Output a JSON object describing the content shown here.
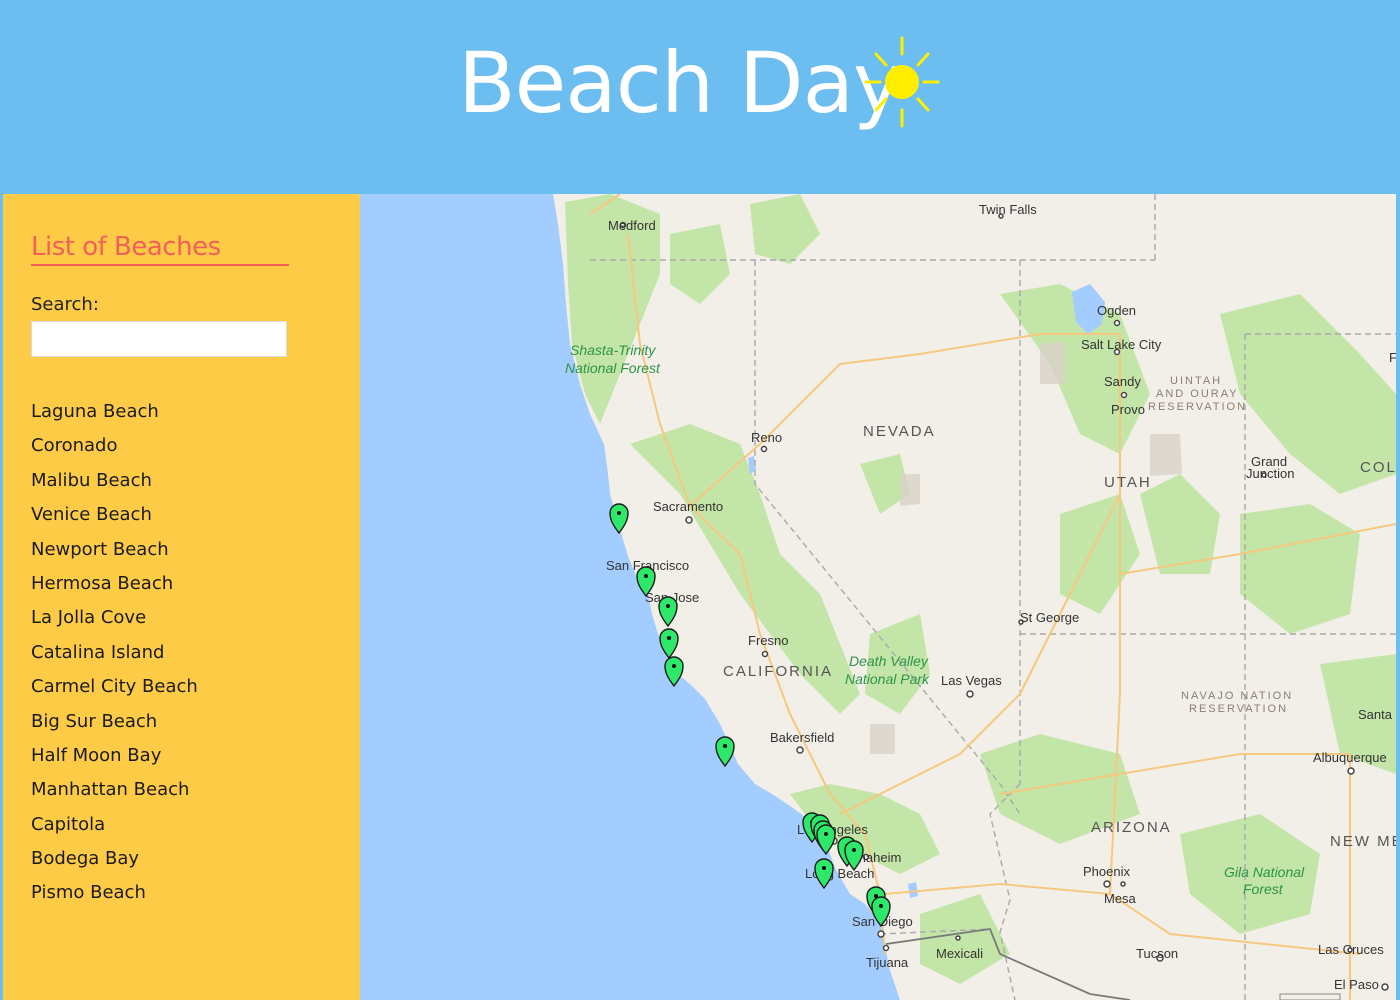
{
  "header": {
    "title": "Beach Day",
    "icon": "sun-icon",
    "background": "#6cbdf0"
  },
  "sidebar": {
    "title": "List of Beaches",
    "search_label": "Search:",
    "search_value": "",
    "background": "#fecb47",
    "accent": "#f2605a",
    "beaches": [
      "Laguna Beach",
      "Coronado",
      "Malibu Beach",
      "Venice Beach",
      "Newport Beach",
      "Hermosa Beach",
      "La Jolla Cove",
      "Catalina Island",
      "Carmel City Beach",
      "Big Sur Beach",
      "Half Moon Bay",
      "Manhattan Beach",
      "Capitola",
      "Bodega Bay",
      "Pismo Beach"
    ]
  },
  "map": {
    "marker_color": "#2ee86a",
    "ocean_color": "#a3ccff",
    "land_color": "#f2efe9",
    "labels": {
      "medford": "Medford",
      "twin_falls": "Twin Falls",
      "ogden": "Ogden",
      "salt_lake_city": "Salt Lake City",
      "sandy": "Sandy",
      "provo": "Provo",
      "uintah_1": "UINTAH",
      "uintah_2": "AND OURAY",
      "uintah_3": "RESERVATION",
      "shasta_1": "Shasta-Trinity",
      "shasta_2": "National Forest",
      "reno": "Reno",
      "nevada": "NEVADA",
      "utah": "UTAH",
      "grand_junction_1": "Grand",
      "grand_junction_2": "Junction",
      "colorado": "COLO",
      "sacramento": "Sacramento",
      "san_francisco": "San Francisco",
      "san_jose": "San Jose",
      "st_george": "St George",
      "fresno": "Fresno",
      "california": "CALIFORNIA",
      "death_valley_1": "Death Valley",
      "death_valley_2": "National Park",
      "las_vegas": "Las Vegas",
      "navajo_1": "NAVAJO NATION",
      "navajo_2": "RESERVATION",
      "santa_fe": "Santa F",
      "bakersfield": "Bakersfield",
      "albuquerque": "Albuquerque",
      "los_angeles": "Los Angeles",
      "anaheim": "Anaheim",
      "long_beach": "Long Beach",
      "arizona": "ARIZONA",
      "new_mexico": "NEW MEX",
      "phoenix": "Phoenix",
      "mesa": "Mesa",
      "gila_1": "Gila National",
      "gila_2": "Forest",
      "san_diego": "San Diego",
      "tijuana": "Tijuana",
      "mexicali": "Mexicali",
      "tucson": "Tucson",
      "las_cruces": "Las Cruces",
      "el_paso": "El Paso",
      "edge_f": "F"
    }
  }
}
